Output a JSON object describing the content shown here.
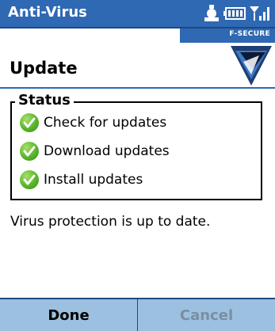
{
  "titlebar": {
    "app_title": "Anti-Virus"
  },
  "header": {
    "page_title": "Update",
    "brand_label": "F-SECURE"
  },
  "status_group": {
    "legend": "Status",
    "items": [
      {
        "label": "Check for updates",
        "icon": "check-circle-icon"
      },
      {
        "label": "Download updates",
        "icon": "check-circle-icon"
      },
      {
        "label": "Install updates",
        "icon": "check-circle-icon"
      }
    ]
  },
  "message": "Virus protection is up to date.",
  "softkeys": {
    "left": "Done",
    "right": "Cancel",
    "right_enabled": false
  },
  "colors": {
    "titlebar": "#2f68b3",
    "softbar": "#9cc0df",
    "check": "#5ab52a"
  }
}
